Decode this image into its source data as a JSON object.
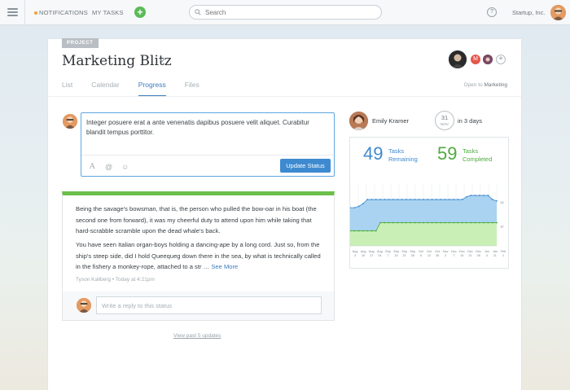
{
  "topbar": {
    "notifications_label": "NOTIFICATIONS",
    "my_tasks_label": "MY TASKS",
    "add_label": "+",
    "search_placeholder": "Search",
    "help_label": "?",
    "org_name": "Startup, Inc."
  },
  "project": {
    "tag": "PROJECT",
    "title": "Marketing Blitz",
    "member_m_initial": "M",
    "add_member_label": "+",
    "tabs": [
      {
        "label": "List"
      },
      {
        "label": "Calendar"
      },
      {
        "label": "Progress"
      },
      {
        "label": "Files"
      }
    ],
    "active_tab": "Progress",
    "open_to_prefix": "Open to",
    "open_to_target": "Marketing"
  },
  "composer": {
    "text": "Integer posuere erat a ante venenatis dapibus posuere velit aliquet. Curabitur blandit tempus porttitor.",
    "tool_icons": [
      "text-format-icon",
      "mention-icon",
      "emoji-icon"
    ],
    "tool_glyphs": [
      "A",
      "@",
      "☺"
    ],
    "submit_label": "Update Status"
  },
  "status_post": {
    "paragraph1": "Being the savage's bowsman, that is, the person who pulled the bow-oar in his boat (the second one from forward), it was my cheerful duty to attend upon him while taking that hard-scrabble scramble upon the dead whale's back.",
    "paragraph2": "You have seen Italian organ-boys holding a dancing-ape by a long cord. Just so, from the ship's steep side, did I hold Queequeg down there in the sea, by what is technically called in the fishery a monkey-rope, attached to a str …",
    "see_more_label": "See More",
    "author": "Tyson Kallberg",
    "separator": "•",
    "timestamp": "Today at 4:21pm",
    "accent_color": "#6bbf4a",
    "reply_placeholder": "Write a reply to this status",
    "view_past_label": "View past 5 updates"
  },
  "sidebar": {
    "owner_name": "Emily Kramer",
    "due_day": "31",
    "due_month": "NOV",
    "due_text": "in 3 days",
    "remaining_count": "49",
    "remaining_label_1": "Tasks",
    "remaining_label_2": "Remaining",
    "completed_count": "59",
    "completed_label_1": "Tasks",
    "completed_label_2": "Completed",
    "remaining_color": "#3e8ad0",
    "completed_color": "#4faa3f"
  },
  "chart_data": {
    "type": "area",
    "x_ticks": [
      [
        "Aug",
        "3"
      ],
      [
        "Aug",
        "10"
      ],
      [
        "Aug",
        "17"
      ],
      [
        "Aug",
        "24"
      ],
      [
        "Sep",
        "7"
      ],
      [
        "Sep",
        "14"
      ],
      [
        "Sep",
        "21"
      ],
      [
        "Sep",
        "28"
      ],
      [
        "Oct",
        "5"
      ],
      [
        "Oct",
        "12"
      ],
      [
        "Oct",
        "26"
      ],
      [
        "Nov",
        "2"
      ],
      [
        "Dec",
        "7"
      ],
      [
        "Dec",
        "14"
      ],
      [
        "Dec",
        "21"
      ],
      [
        "Dec",
        "28"
      ],
      [
        "Jan",
        "4"
      ],
      [
        "Jan",
        "11"
      ],
      [
        "Feb",
        "1"
      ]
    ],
    "series": [
      {
        "name": "Total",
        "color": "#a9d3f0",
        "values": [
          28,
          28,
          29,
          31,
          34,
          34,
          34,
          34,
          34,
          34,
          34,
          34,
          34,
          34,
          34,
          34,
          34,
          34,
          34,
          34,
          34,
          34,
          34,
          34,
          34,
          34,
          34,
          36,
          37,
          37,
          37,
          37,
          37,
          34,
          33
        ]
      },
      {
        "name": "Completed",
        "color": "#c9efb6",
        "values": [
          11,
          11,
          11,
          11,
          11,
          11,
          11,
          17,
          17,
          17,
          17,
          17,
          17,
          17,
          17,
          17,
          17,
          17,
          17,
          17,
          17,
          17,
          17,
          17,
          17,
          17,
          17,
          17,
          17,
          17,
          17,
          17,
          17,
          17,
          17
        ]
      }
    ],
    "y_tick_labels": [
      "13",
      "12"
    ],
    "ylim": [
      0,
      46
    ]
  }
}
